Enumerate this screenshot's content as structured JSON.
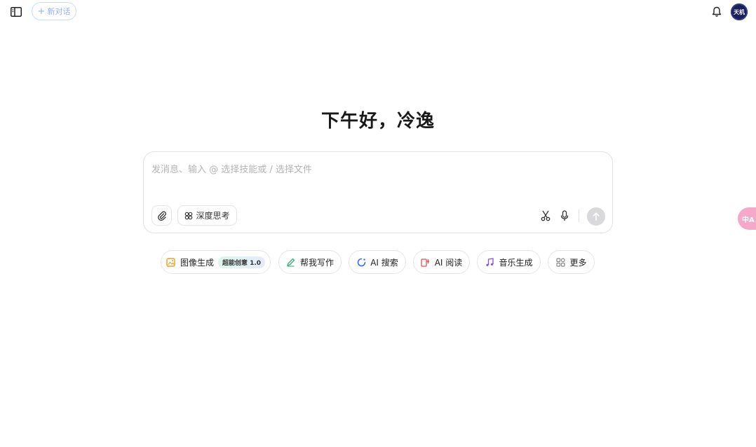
{
  "header": {
    "new_chat_label": "新对话",
    "avatar_text": "天机"
  },
  "greeting": "下午好，冷逸",
  "composer": {
    "placeholder": "发消息、输入 @ 选择技能或 / 选择文件",
    "deep_think_label": "深度思考"
  },
  "quick_actions": [
    {
      "label": "图像生成",
      "badge": "超能创意 1.0",
      "icon": "image-icon",
      "color": "#f0a020"
    },
    {
      "label": "帮我写作",
      "icon": "pen-icon",
      "color": "#2fb26b"
    },
    {
      "label": "AI 搜索",
      "icon": "search-icon",
      "color": "#2f6bff"
    },
    {
      "label": "AI 阅读",
      "icon": "read-icon",
      "color": "#f04a4a"
    },
    {
      "label": "音乐生成",
      "icon": "music-icon",
      "color": "#8a4cf0"
    },
    {
      "label": "更多",
      "icon": "more-icon",
      "color": "#888888"
    }
  ],
  "side_float_text": "中A"
}
